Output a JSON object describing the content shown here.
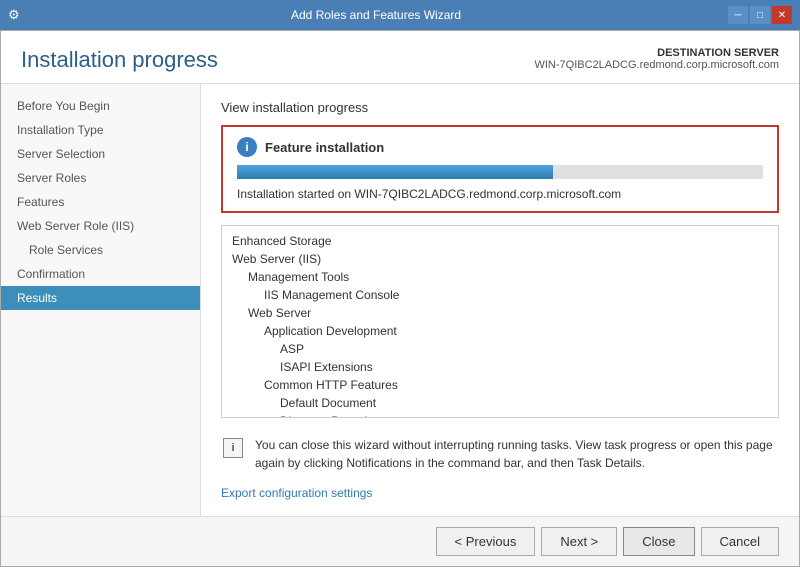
{
  "titlebar": {
    "title": "Add Roles and Features Wizard",
    "icon": "⚙",
    "controls": [
      "minimize",
      "maximize",
      "close"
    ]
  },
  "header": {
    "title": "Installation progress",
    "destination_label": "DESTINATION SERVER",
    "destination_server": "WIN-7QIBC2LADCG.redmond.corp.microsoft.com"
  },
  "sidebar": {
    "items": [
      {
        "label": "Before You Begin",
        "level": 0,
        "active": false
      },
      {
        "label": "Installation Type",
        "level": 0,
        "active": false
      },
      {
        "label": "Server Selection",
        "level": 0,
        "active": false
      },
      {
        "label": "Server Roles",
        "level": 0,
        "active": false
      },
      {
        "label": "Features",
        "level": 0,
        "active": false
      },
      {
        "label": "Web Server Role (IIS)",
        "level": 0,
        "active": false
      },
      {
        "label": "Role Services",
        "level": 1,
        "active": false
      },
      {
        "label": "Confirmation",
        "level": 0,
        "active": false
      },
      {
        "label": "Results",
        "level": 0,
        "active": true
      }
    ]
  },
  "main": {
    "view_title": "View installation progress",
    "feature_box": {
      "title": "Feature installation",
      "progress": 60,
      "status": "Installation started on WIN-7QIBC2LADCG.redmond.corp.microsoft.com"
    },
    "feature_list": [
      {
        "label": "Enhanced Storage",
        "level": 0
      },
      {
        "label": "Web Server (IIS)",
        "level": 0
      },
      {
        "label": "Management Tools",
        "level": 1
      },
      {
        "label": "IIS Management Console",
        "level": 2
      },
      {
        "label": "Web Server",
        "level": 1
      },
      {
        "label": "Application Development",
        "level": 2
      },
      {
        "label": "ASP",
        "level": 3
      },
      {
        "label": "ISAPI Extensions",
        "level": 3
      },
      {
        "label": "Common HTTP Features",
        "level": 2
      },
      {
        "label": "Default Document",
        "level": 3
      },
      {
        "label": "Directory Browsing",
        "level": 3
      }
    ],
    "note_text": "You can close this wizard without interrupting running tasks. View task progress or open this page again by clicking Notifications in the command bar, and then Task Details.",
    "export_link": "Export configuration settings"
  },
  "footer": {
    "previous_label": "< Previous",
    "next_label": "Next >",
    "close_label": "Close",
    "cancel_label": "Cancel"
  }
}
